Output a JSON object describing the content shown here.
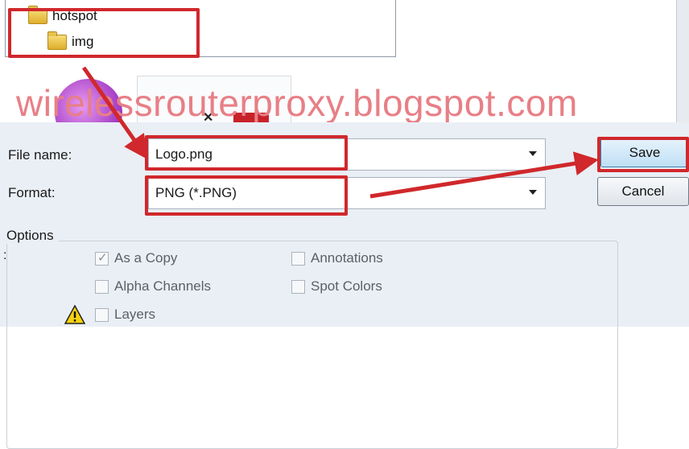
{
  "folder_tree": {
    "items": [
      {
        "label": "hotspot",
        "icon": "folder-icon"
      },
      {
        "label": "img",
        "icon": "folder-icon"
      }
    ]
  },
  "watermark": {
    "text": "wirelessrouterproxy.blogspot.com",
    "color": "#e87f86"
  },
  "save_dialog": {
    "file_name_label": "File name:",
    "file_name_value": "Logo.png",
    "format_label": "Format:",
    "format_value": "PNG (*.PNG)",
    "save_label": "Save",
    "cancel_label": "Cancel"
  },
  "options": {
    "title": "Options",
    "stray_colon": ":",
    "as_a_copy": {
      "label": "As a Copy",
      "checked": true
    },
    "alpha_channels": {
      "label": "Alpha Channels",
      "checked": false
    },
    "layers": {
      "label": "Layers",
      "checked": false
    },
    "annotations": {
      "label": "Annotations",
      "checked": false
    },
    "spot_colors": {
      "label": "Spot Colors",
      "checked": false
    },
    "warning_icon": "warning-triangle-icon"
  },
  "annotation_color": "#d0282c"
}
